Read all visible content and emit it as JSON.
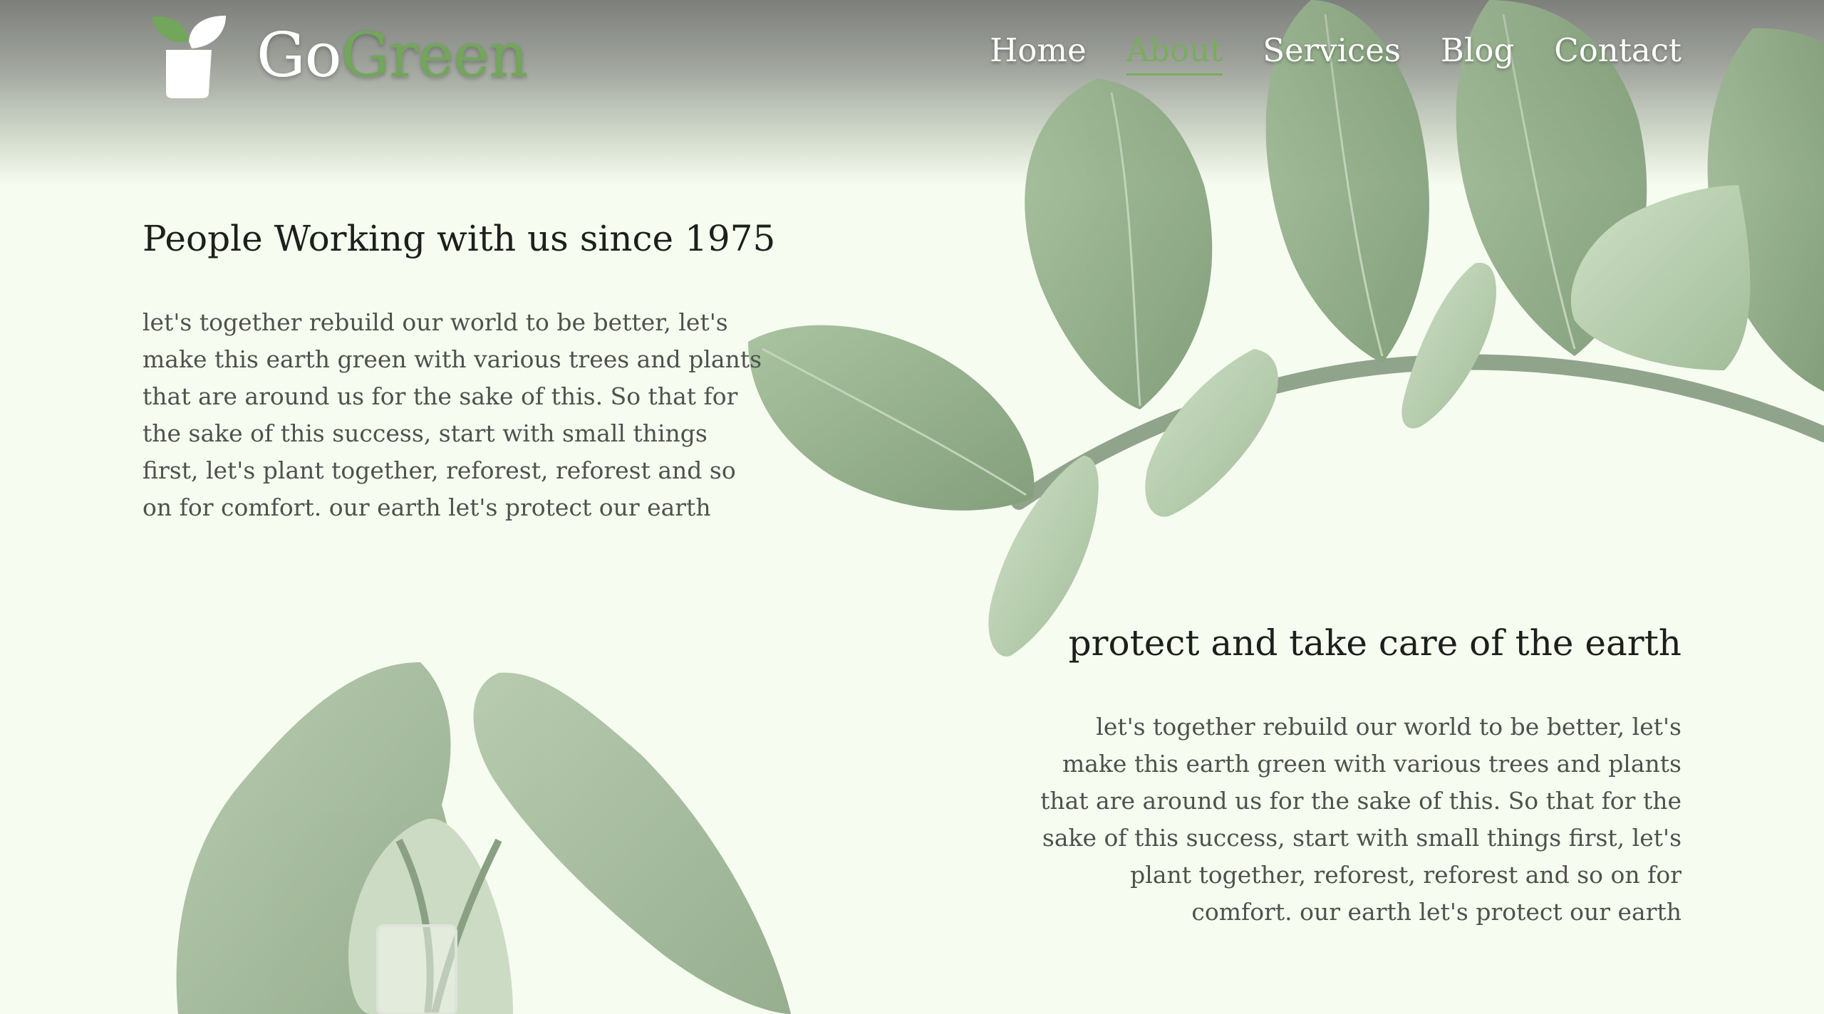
{
  "brand": {
    "logo_icon": "plant-pot-icon",
    "name_part1": "Go",
    "name_part2": "Green",
    "accent_color": "#72a65a"
  },
  "nav": {
    "items": [
      {
        "label": "Home",
        "active": false
      },
      {
        "label": "About",
        "active": true
      },
      {
        "label": "Services",
        "active": false
      },
      {
        "label": "Blog",
        "active": false
      },
      {
        "label": "Contact",
        "active": false
      }
    ]
  },
  "sections": [
    {
      "heading": "People Working with us since 1975",
      "body": "let's together rebuild our world to be better, let's make this earth green with various trees and plants that are around us for the sake of this. So that for the sake of this success, start with small things first, let's plant together, reforest, reforest and so on for comfort. our earth let's protect our earth"
    },
    {
      "heading": "protect and take care of the earth",
      "body": "let's together rebuild our world to be better, let's make this earth green with various trees and plants that are around us for the sake of this. So that for the sake of this success, start with small things first, let's plant together, reforest, reforest and so on for comfort. our earth let's protect our earth"
    }
  ],
  "decor": {
    "top_right": "leafy-branch-image",
    "bottom_left": "plant-in-glass-vase-image"
  }
}
